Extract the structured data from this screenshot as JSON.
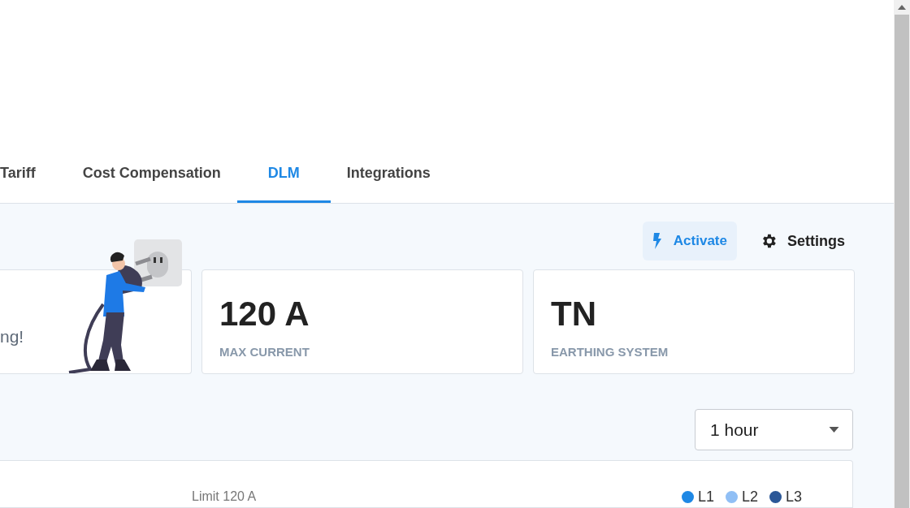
{
  "tabs": [
    {
      "label": "Tariff",
      "selected": false
    },
    {
      "label": "Cost Compensation",
      "selected": false
    },
    {
      "label": "DLM",
      "selected": true
    },
    {
      "label": "Integrations",
      "selected": false
    }
  ],
  "actions": {
    "activate": "Activate",
    "settings": "Settings"
  },
  "cards": [
    {
      "kind": "info",
      "text": "ng!"
    },
    {
      "kind": "stat",
      "value": "120 A",
      "label": "MAX CURRENT"
    },
    {
      "kind": "stat",
      "value": "TN",
      "label": "EARTHING SYSTEM"
    }
  ],
  "period_select": {
    "value": "1 hour"
  },
  "chart": {
    "limit_label": "Limit 120 A",
    "legend": [
      {
        "name": "L1",
        "color": "#1e88e5"
      },
      {
        "name": "L2",
        "color": "#90bff5"
      },
      {
        "name": "L3",
        "color": "#2b5797"
      }
    ]
  }
}
